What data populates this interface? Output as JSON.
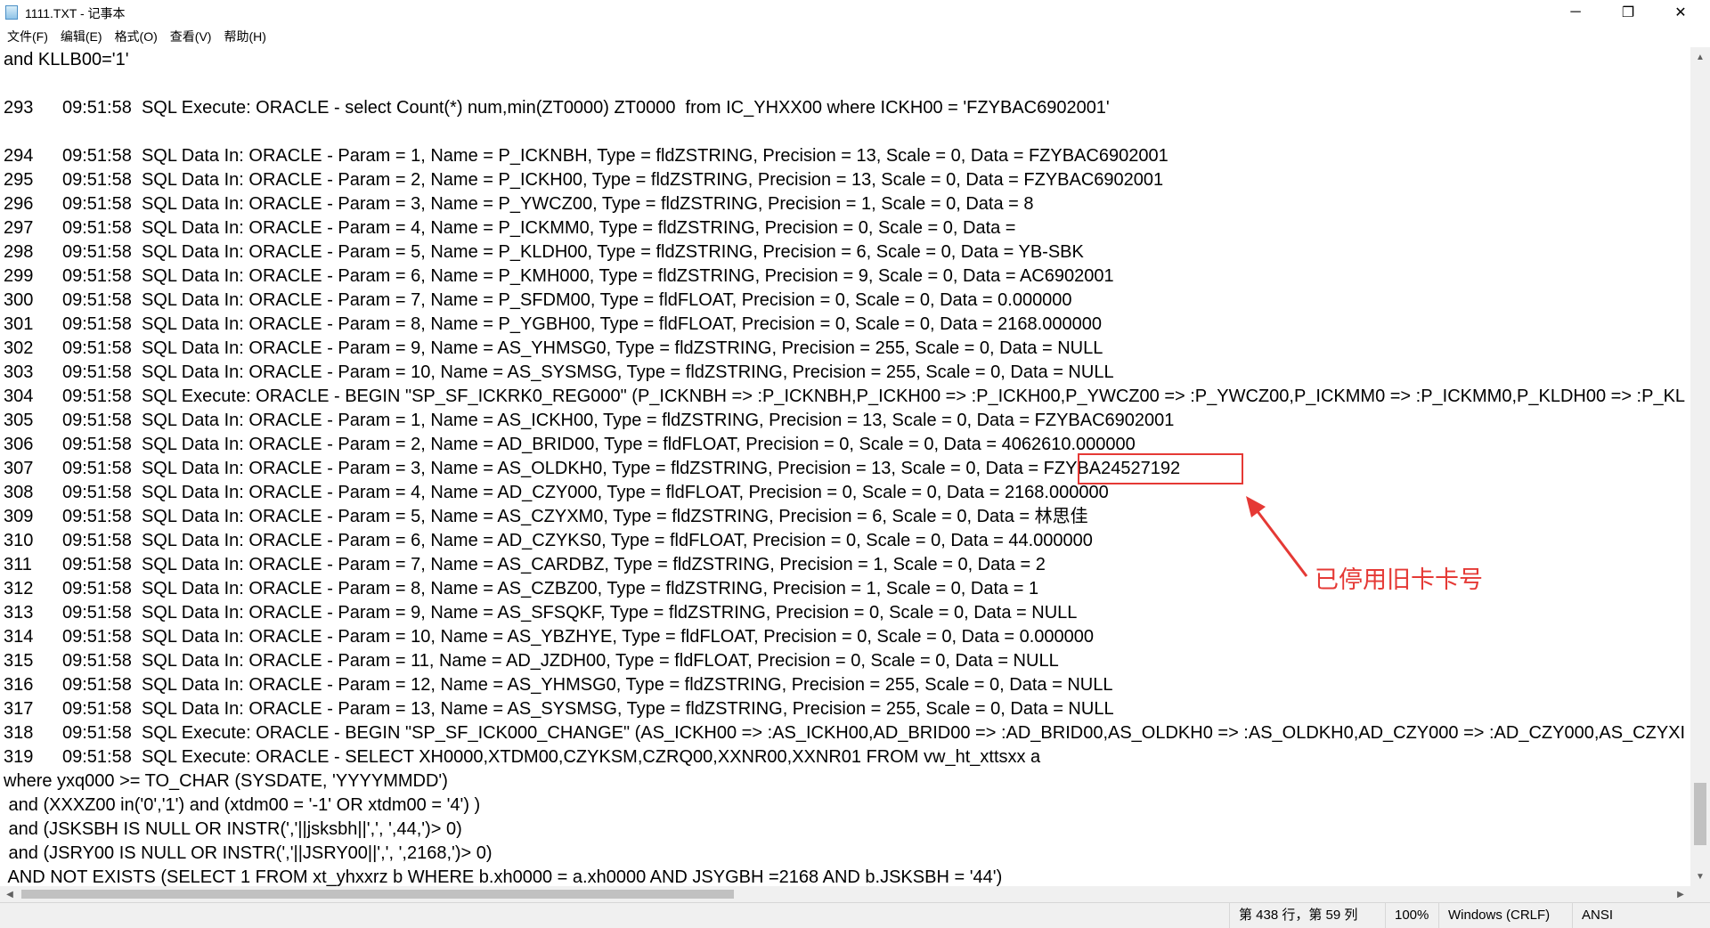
{
  "window": {
    "title": "1111.TXT - 记事本",
    "minimize_glyph": "─",
    "maximize_glyph": "❐",
    "close_glyph": "✕"
  },
  "menu": [
    "文件(F)",
    "编辑(E)",
    "格式(O)",
    "查看(V)",
    "帮助(H)"
  ],
  "lines": [
    {
      "no": "",
      "text": "and KLLB00='1'"
    },
    {
      "no": "",
      "text": ""
    },
    {
      "no": "293",
      "text": "09:51:58  SQL Execute: ORACLE - select Count(*) num,min(ZT0000) ZT0000  from IC_YHXX00 where ICKH00 = 'FZYBAC6902001'"
    },
    {
      "no": "",
      "text": ""
    },
    {
      "no": "294",
      "text": "09:51:58  SQL Data In: ORACLE - Param = 1, Name = P_ICKNBH, Type = fldZSTRING, Precision = 13, Scale = 0, Data = FZYBAC6902001"
    },
    {
      "no": "295",
      "text": "09:51:58  SQL Data In: ORACLE - Param = 2, Name = P_ICKH00, Type = fldZSTRING, Precision = 13, Scale = 0, Data = FZYBAC6902001"
    },
    {
      "no": "296",
      "text": "09:51:58  SQL Data In: ORACLE - Param = 3, Name = P_YWCZ00, Type = fldZSTRING, Precision = 1, Scale = 0, Data = 8"
    },
    {
      "no": "297",
      "text": "09:51:58  SQL Data In: ORACLE - Param = 4, Name = P_ICKMM0, Type = fldZSTRING, Precision = 0, Scale = 0, Data ="
    },
    {
      "no": "298",
      "text": "09:51:58  SQL Data In: ORACLE - Param = 5, Name = P_KLDH00, Type = fldZSTRING, Precision = 6, Scale = 0, Data = YB-SBK"
    },
    {
      "no": "299",
      "text": "09:51:58  SQL Data In: ORACLE - Param = 6, Name = P_KMH000, Type = fldZSTRING, Precision = 9, Scale = 0, Data = AC6902001"
    },
    {
      "no": "300",
      "text": "09:51:58  SQL Data In: ORACLE - Param = 7, Name = P_SFDM00, Type = fldFLOAT, Precision = 0, Scale = 0, Data = 0.000000"
    },
    {
      "no": "301",
      "text": "09:51:58  SQL Data In: ORACLE - Param = 8, Name = P_YGBH00, Type = fldFLOAT, Precision = 0, Scale = 0, Data = 2168.000000"
    },
    {
      "no": "302",
      "text": "09:51:58  SQL Data In: ORACLE - Param = 9, Name = AS_YHMSG0, Type = fldZSTRING, Precision = 255, Scale = 0, Data = NULL"
    },
    {
      "no": "303",
      "text": "09:51:58  SQL Data In: ORACLE - Param = 10, Name = AS_SYSMSG, Type = fldZSTRING, Precision = 255, Scale = 0, Data = NULL"
    },
    {
      "no": "304",
      "text": "09:51:58  SQL Execute: ORACLE - BEGIN \"SP_SF_ICKRK0_REG000\" (P_ICKNBH => :P_ICKNBH,P_ICKH00 => :P_ICKH00,P_YWCZ00 => :P_YWCZ00,P_ICKMM0 => :P_ICKMM0,P_KLDH00 => :P_KL"
    },
    {
      "no": "305",
      "text": "09:51:58  SQL Data In: ORACLE - Param = 1, Name = AS_ICKH00, Type = fldZSTRING, Precision = 13, Scale = 0, Data = FZYBAC6902001"
    },
    {
      "no": "306",
      "text": "09:51:58  SQL Data In: ORACLE - Param = 2, Name = AD_BRID00, Type = fldFLOAT, Precision = 0, Scale = 0, Data = 4062610.000000"
    },
    {
      "no": "307",
      "text": "09:51:58  SQL Data In: ORACLE - Param = 3, Name = AS_OLDKH0, Type = fldZSTRING, Precision = 13, Scale = 0, Data = FZYBA24527192"
    },
    {
      "no": "308",
      "text": "09:51:58  SQL Data In: ORACLE - Param = 4, Name = AD_CZY000, Type = fldFLOAT, Precision = 0, Scale = 0, Data = 2168.000000"
    },
    {
      "no": "309",
      "text": "09:51:58  SQL Data In: ORACLE - Param = 5, Name = AS_CZYXM0, Type = fldZSTRING, Precision = 6, Scale = 0, Data = 林思佳"
    },
    {
      "no": "310",
      "text": "09:51:58  SQL Data In: ORACLE - Param = 6, Name = AD_CZYKS0, Type = fldFLOAT, Precision = 0, Scale = 0, Data = 44.000000"
    },
    {
      "no": "311",
      "text": "09:51:58  SQL Data In: ORACLE - Param = 7, Name = AS_CARDBZ, Type = fldZSTRING, Precision = 1, Scale = 0, Data = 2"
    },
    {
      "no": "312",
      "text": "09:51:58  SQL Data In: ORACLE - Param = 8, Name = AS_CZBZ00, Type = fldZSTRING, Precision = 1, Scale = 0, Data = 1"
    },
    {
      "no": "313",
      "text": "09:51:58  SQL Data In: ORACLE - Param = 9, Name = AS_SFSQKF, Type = fldZSTRING, Precision = 0, Scale = 0, Data = NULL"
    },
    {
      "no": "314",
      "text": "09:51:58  SQL Data In: ORACLE - Param = 10, Name = AS_YBZHYE, Type = fldFLOAT, Precision = 0, Scale = 0, Data = 0.000000"
    },
    {
      "no": "315",
      "text": "09:51:58  SQL Data In: ORACLE - Param = 11, Name = AD_JZDH00, Type = fldFLOAT, Precision = 0, Scale = 0, Data = NULL"
    },
    {
      "no": "316",
      "text": "09:51:58  SQL Data In: ORACLE - Param = 12, Name = AS_YHMSG0, Type = fldZSTRING, Precision = 255, Scale = 0, Data = NULL"
    },
    {
      "no": "317",
      "text": "09:51:58  SQL Data In: ORACLE - Param = 13, Name = AS_SYSMSG, Type = fldZSTRING, Precision = 255, Scale = 0, Data = NULL"
    },
    {
      "no": "318",
      "text": "09:51:58  SQL Execute: ORACLE - BEGIN \"SP_SF_ICK000_CHANGE\" (AS_ICKH00 => :AS_ICKH00,AD_BRID00 => :AD_BRID00,AS_OLDKH0 => :AS_OLDKH0,AD_CZY000 => :AD_CZY000,AS_CZYXI"
    },
    {
      "no": "319",
      "text": "09:51:58  SQL Execute: ORACLE - SELECT XH0000,XTDM00,CZYKSM,CZRQ00,XXNR00,XXNR01 FROM vw_ht_xttsxx a"
    },
    {
      "no": "",
      "text": "where yxq000 >= TO_CHAR (SYSDATE, 'YYYYMMDD')"
    },
    {
      "no": "",
      "text": " and (XXXZ00 in('0','1') and (xtdm00 = '-1' OR xtdm00 = '4') )"
    },
    {
      "no": "",
      "text": " and (JSKSBH IS NULL OR INSTR(','||jsksbh||',', ',44,')> 0)"
    },
    {
      "no": "",
      "text": " and (JSRY00 IS NULL OR INSTR(','||JSRY00||',', ',2168,')> 0)"
    },
    {
      "no": "",
      "text": " AND NOT EXISTS (SELECT 1 FROM xt_yhxxrz b WHERE b.xh0000 = a.xh0000 AND JSYGBH =2168 AND b.JSKSBH = '44')"
    }
  ],
  "annotation": {
    "label": "已停用旧卡卡号",
    "color": "#e53935"
  },
  "status": {
    "position": "第 438 行，第 59 列",
    "zoom": "100%",
    "line_ending": "Windows (CRLF)",
    "encoding": "ANSI"
  }
}
